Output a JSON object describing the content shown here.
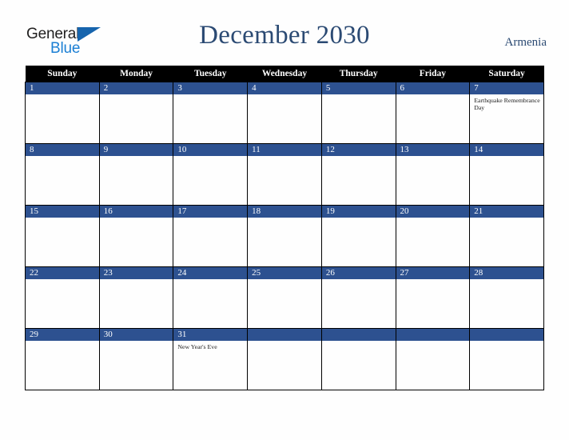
{
  "brand": {
    "name_part1": "General",
    "name_part2": "Blue",
    "triangle_icon": "triangle-icon",
    "colors": {
      "dark_text": "#201f1f",
      "blue_text": "#1b7fd4",
      "triangle": "#1664ad"
    }
  },
  "header": {
    "title": "December 2030",
    "country": "Armenia",
    "title_color": "#2b4a73"
  },
  "calendar": {
    "month": "December",
    "year": "2030",
    "weekday_headers": [
      "Sunday",
      "Monday",
      "Tuesday",
      "Wednesday",
      "Thursday",
      "Friday",
      "Saturday"
    ],
    "header_bg": "#000000",
    "day_band_bg": "#2d5190",
    "grid_border": "#000000",
    "weeks": [
      [
        {
          "day": "1",
          "events": []
        },
        {
          "day": "2",
          "events": []
        },
        {
          "day": "3",
          "events": []
        },
        {
          "day": "4",
          "events": []
        },
        {
          "day": "5",
          "events": []
        },
        {
          "day": "6",
          "events": []
        },
        {
          "day": "7",
          "events": [
            "Earthquake Remembrance Day"
          ]
        }
      ],
      [
        {
          "day": "8",
          "events": []
        },
        {
          "day": "9",
          "events": []
        },
        {
          "day": "10",
          "events": []
        },
        {
          "day": "11",
          "events": []
        },
        {
          "day": "12",
          "events": []
        },
        {
          "day": "13",
          "events": []
        },
        {
          "day": "14",
          "events": []
        }
      ],
      [
        {
          "day": "15",
          "events": []
        },
        {
          "day": "16",
          "events": []
        },
        {
          "day": "17",
          "events": []
        },
        {
          "day": "18",
          "events": []
        },
        {
          "day": "19",
          "events": []
        },
        {
          "day": "20",
          "events": []
        },
        {
          "day": "21",
          "events": []
        }
      ],
      [
        {
          "day": "22",
          "events": []
        },
        {
          "day": "23",
          "events": []
        },
        {
          "day": "24",
          "events": []
        },
        {
          "day": "25",
          "events": []
        },
        {
          "day": "26",
          "events": []
        },
        {
          "day": "27",
          "events": []
        },
        {
          "day": "28",
          "events": []
        }
      ],
      [
        {
          "day": "29",
          "events": []
        },
        {
          "day": "30",
          "events": []
        },
        {
          "day": "31",
          "events": [
            "New Year's Eve"
          ]
        },
        {
          "day": "",
          "events": []
        },
        {
          "day": "",
          "events": []
        },
        {
          "day": "",
          "events": []
        },
        {
          "day": "",
          "events": []
        }
      ]
    ]
  }
}
